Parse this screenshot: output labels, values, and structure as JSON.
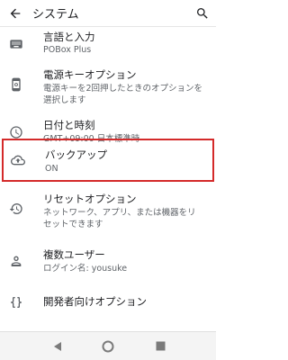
{
  "app_bar": {
    "title": "システム",
    "back_icon": "arrow-back-icon",
    "search_icon": "search-icon"
  },
  "items": [
    {
      "title": "言語と入力",
      "subtitle": "POBox Plus",
      "icon": "keyboard-icon"
    },
    {
      "title": "電源キーオプション",
      "subtitle": "電源キーを2回押したときのオプションを選択します",
      "icon": "phone-power-icon"
    },
    {
      "title": "日付と時刻",
      "subtitle": "GMT+09:00 日本標準時",
      "icon": "clock-icon"
    },
    {
      "title": "バックアップ",
      "subtitle": "ON",
      "icon": "cloud-upload-icon"
    },
    {
      "title": "リセットオプション",
      "subtitle": "ネットワーク、アプリ、または機器をリセットできます",
      "icon": "history-icon"
    },
    {
      "title": "複数ユーザー",
      "subtitle": "ログイン名: yousuke",
      "icon": "person-icon"
    },
    {
      "title": "開発者向けオプション",
      "subtitle": "",
      "icon": "code-braces-icon"
    }
  ],
  "colors": {
    "highlight_border": "#d42a2a",
    "icon": "#5f6368",
    "text_primary": "#202124",
    "text_secondary": "#5f6368"
  },
  "nav_bar": {
    "back": "nav-back-icon",
    "home": "nav-home-icon",
    "recents": "nav-recents-icon"
  }
}
